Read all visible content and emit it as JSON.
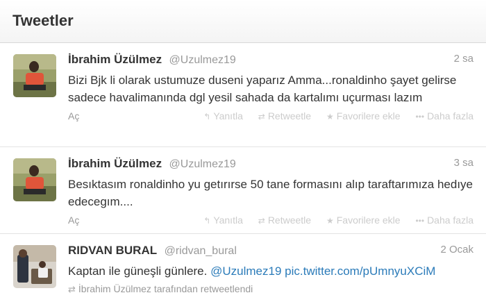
{
  "header": {
    "title": "Tweetler"
  },
  "tweets": [
    {
      "name": "İbrahim Üzülmez",
      "handle": "@Uzulmez19",
      "time": "2 sa",
      "text": "Bizi Bjk li olarak ustumuze duseni yaparız Amma...ronaldinho şayet gelirse sadece havalimanında dgl yesil sahada da kartalımı uçurması lazım",
      "expand": "Aç",
      "actions": {
        "reply": "Yanıtla",
        "retweet": "Retweetle",
        "favorite": "Favorilere ekle",
        "more": "Daha fazla"
      }
    },
    {
      "name": "İbrahim Üzülmez",
      "handle": "@Uzulmez19",
      "time": "3 sa",
      "text": "Besıktasım ronaldinho yu getırırse 50 tane formasını alıp taraftarımıza hedıye edecegım....",
      "expand": "Aç",
      "actions": {
        "reply": "Yanıtla",
        "retweet": "Retweetle",
        "favorite": "Favorilere ekle",
        "more": "Daha fazla"
      }
    },
    {
      "name": "RIDVAN BURAL",
      "handle": "@ridvan_bural",
      "time": "2 Ocak",
      "text": "Kaptan ile güneşli günlere.",
      "mention": "@Uzulmez19",
      "pic_link": "pic.twitter.com/pUmnyuXCiM",
      "retweeted_by": "İbrahim Üzülmez tarafından retweetlendi"
    }
  ],
  "icons": {
    "reply": "reply-icon",
    "retweet": "retweet-icon",
    "favorite": "star-icon",
    "more": "more-dots-icon"
  },
  "colors": {
    "link": "#2b7bb9",
    "muted": "#999999",
    "action": "#cccccc"
  }
}
